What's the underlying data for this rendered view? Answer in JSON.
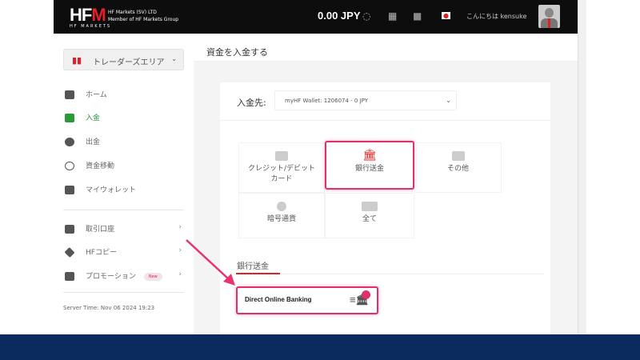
{
  "header": {
    "logo": "HFM",
    "logo_sub": "HF MARKETS",
    "company_line1": "HF Markets (SV) LTD",
    "company_line2": "Member of HF Markets Group",
    "balance": "0.00 JPY",
    "greeting": "こんにちは kensuke"
  },
  "sidebar": {
    "area_label": "トレーダーズエリア",
    "items": [
      {
        "label": "ホーム"
      },
      {
        "label": "入金"
      },
      {
        "label": "出金"
      },
      {
        "label": "資金移動"
      },
      {
        "label": "マイウォレット"
      },
      {
        "label": "取引口座"
      },
      {
        "label": "HFコピー"
      },
      {
        "label": "プロモーション",
        "badge": "New"
      }
    ],
    "server_time": "Server Time: Nov 06 2024 19:23"
  },
  "main": {
    "title": "資金を入金する",
    "dest_label": "入金先:",
    "dest_value": "myHF Wallet: 1206074 - 0 JPY",
    "methods": [
      {
        "label": "クレジット/デビットカード"
      },
      {
        "label": "銀行送金"
      },
      {
        "label": "その他"
      },
      {
        "label": "暗号通貨"
      },
      {
        "label": "全て"
      }
    ],
    "section_title": "銀行送金",
    "option": "Direct Online Banking"
  },
  "colors": {
    "accent": "#e0306a",
    "brand": "#e0212b",
    "active": "#2a9a3a",
    "footer": "#0b2b5e"
  }
}
